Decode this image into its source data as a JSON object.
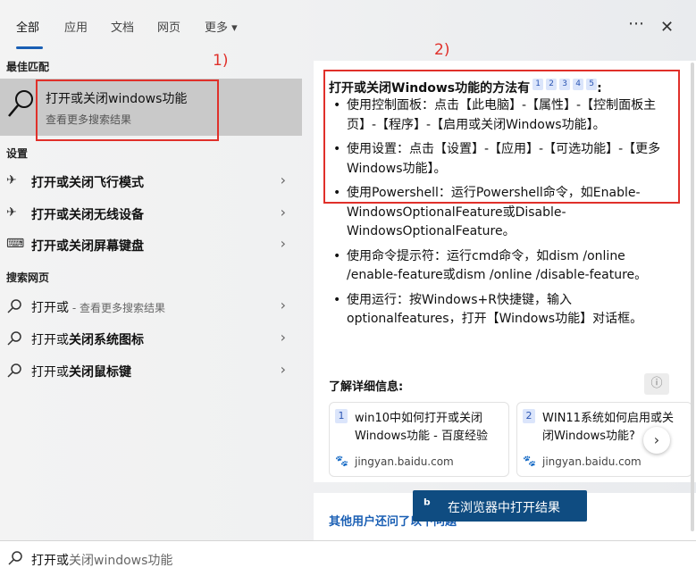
{
  "tabs": [
    {
      "label": "全部"
    },
    {
      "label": "应用"
    },
    {
      "label": "文档"
    },
    {
      "label": "网页"
    },
    {
      "label": "更多 ▾"
    }
  ],
  "top_icons": {
    "more": "⋯",
    "close": "✕"
  },
  "sections": {
    "best_match": "最佳匹配",
    "settings": "设置",
    "web": "搜索网页"
  },
  "best_match": {
    "title": "打开或关闭windows功能",
    "subtitle": "查看更多搜索结果"
  },
  "annotations": {
    "one": "1)",
    "two": "2)"
  },
  "settings_items": [
    {
      "bold": "打开或关闭飞行模式",
      "icon": "airplane-icon"
    },
    {
      "bold": "打开或关闭无线设备",
      "icon": "airplane-icon"
    },
    {
      "bold": "打开或关闭屏幕键盘",
      "icon": "keyboard-icon"
    }
  ],
  "web_items": [
    {
      "prefix": "打开或",
      "suffix": " - 查看更多搜索结果"
    },
    {
      "prefix": "打开或",
      "bold": "关闭系统图标"
    },
    {
      "prefix": "打开或",
      "bold": "关闭鼠标键"
    }
  ],
  "answer": {
    "title": "打开或关闭Windows功能的方法有",
    "cites": [
      "1",
      "2",
      "3",
      "4",
      "5"
    ],
    "title_end": ":",
    "bullets": [
      "使用控制面板：点击【此电脑】-【属性】-【控制面板主页】-【程序】-【启用或关闭Windows功能】。",
      "使用设置：点击【设置】-【应用】-【可选功能】-【更多Windows功能】。",
      "使用Powershell：运行Powershell命令，如Enable-WindowsOptionalFeature或Disable-WindowsOptionalFeature。",
      "使用命令提示符：运行cmd命令，如dism /online /enable-feature或dism /online /disable-feature。",
      "使用运行：按Windows+R快捷键，输入optionalfeatures，打开【Windows功能】对话框。"
    ]
  },
  "learn_more": "了解详细信息:",
  "info_icon": "ⓘ",
  "sources": [
    {
      "num": "1",
      "title": "win10中如何打开或关闭Windows功能 - 百度经验",
      "domain": "jingyan.baidu.com"
    },
    {
      "num": "2",
      "title": "WIN11系统如何启用或关闭Windows功能?",
      "domain": "jingyan.baidu.com"
    }
  ],
  "others_asked": "其他用户还问了以下问题",
  "open_in_browser": "在浏览器中打开结果",
  "search": {
    "typed": "打开或",
    "rest": "关闭windows功能"
  },
  "colors": {
    "accent": "#1a5fb4",
    "annotation_red": "#e0302a",
    "button": "#0f4c81"
  }
}
